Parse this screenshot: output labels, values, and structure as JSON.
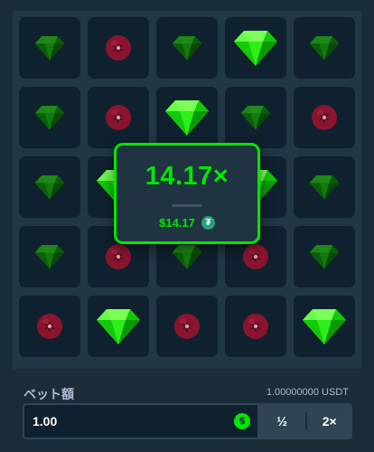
{
  "board": {
    "rows": [
      [
        "gem",
        "mine",
        "gem",
        "gem-revealed",
        "gem"
      ],
      [
        "gem",
        "mine",
        "gem-revealed",
        "gem",
        "mine"
      ],
      [
        "gem",
        "gem-revealed",
        "gem-revealed",
        "gem-revealed",
        "gem"
      ],
      [
        "gem",
        "mine",
        "gem",
        "mine",
        "gem"
      ],
      [
        "mine",
        "gem-revealed",
        "mine",
        "mine",
        "gem-revealed"
      ]
    ]
  },
  "result": {
    "multiplier": "14.17×",
    "amount": "$14.17",
    "currency_icon": "tether-icon"
  },
  "bet": {
    "label": "ベット額",
    "balance": "1.00000000 USDT",
    "amount": "1.00",
    "currency_icon": "dollar-coin-icon",
    "half_label": "½",
    "double_label": "2×"
  },
  "colors": {
    "accent": "#00e701",
    "background": "#1a2c38",
    "tile": "#0f212e",
    "mine": "#8a1430"
  }
}
